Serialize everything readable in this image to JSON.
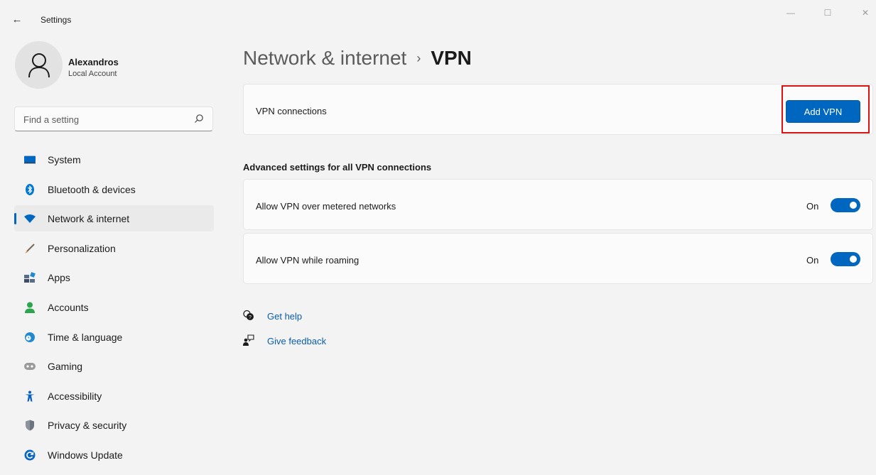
{
  "window": {
    "title": "Settings",
    "controls": {
      "minimize": "—",
      "maximize": "☐",
      "close": "✕"
    }
  },
  "profile": {
    "name": "Alexandros",
    "account_type": "Local Account"
  },
  "search": {
    "placeholder": "Find a setting",
    "value": ""
  },
  "sidebar": {
    "items": [
      {
        "label": "System",
        "icon": "system-icon",
        "color": "#0067c0",
        "active": false
      },
      {
        "label": "Bluetooth & devices",
        "icon": "bluetooth-icon",
        "color": "#0078d4",
        "active": false
      },
      {
        "label": "Network & internet",
        "icon": "wifi-icon",
        "color": "#0067c0",
        "active": true
      },
      {
        "label": "Personalization",
        "icon": "brush-icon",
        "color": "#e88a34",
        "active": false
      },
      {
        "label": "Apps",
        "icon": "apps-icon",
        "color": "#5a6b86",
        "active": false
      },
      {
        "label": "Accounts",
        "icon": "accounts-icon",
        "color": "#2da44e",
        "active": false
      },
      {
        "label": "Time & language",
        "icon": "globe-clock-icon",
        "color": "#1f8ad2",
        "active": false
      },
      {
        "label": "Gaming",
        "icon": "gamepad-icon",
        "color": "#8a8a8a",
        "active": false
      },
      {
        "label": "Accessibility",
        "icon": "accessibility-icon",
        "color": "#0a5fc4",
        "active": false
      },
      {
        "label": "Privacy & security",
        "icon": "shield-icon",
        "color": "#7c8590",
        "active": false
      },
      {
        "label": "Windows Update",
        "icon": "update-icon",
        "color": "#0a66c2",
        "active": false
      }
    ]
  },
  "main": {
    "breadcrumb_parent": "Network & internet",
    "breadcrumb_separator": "›",
    "breadcrumb_current": "VPN",
    "vpn_connections": {
      "label": "VPN connections",
      "button_label": "Add VPN"
    },
    "advanced_title": "Advanced settings for all VPN connections",
    "settings": [
      {
        "label": "Allow VPN over metered networks",
        "state": "On",
        "enabled": true
      },
      {
        "label": "Allow VPN while roaming",
        "state": "On",
        "enabled": true
      }
    ],
    "links": {
      "get_help": "Get help",
      "give_feedback": "Give feedback"
    }
  },
  "colors": {
    "accent": "#0067c0",
    "highlight": "#e01010",
    "background": "#f3f3f3",
    "card": "#fbfbfb"
  }
}
